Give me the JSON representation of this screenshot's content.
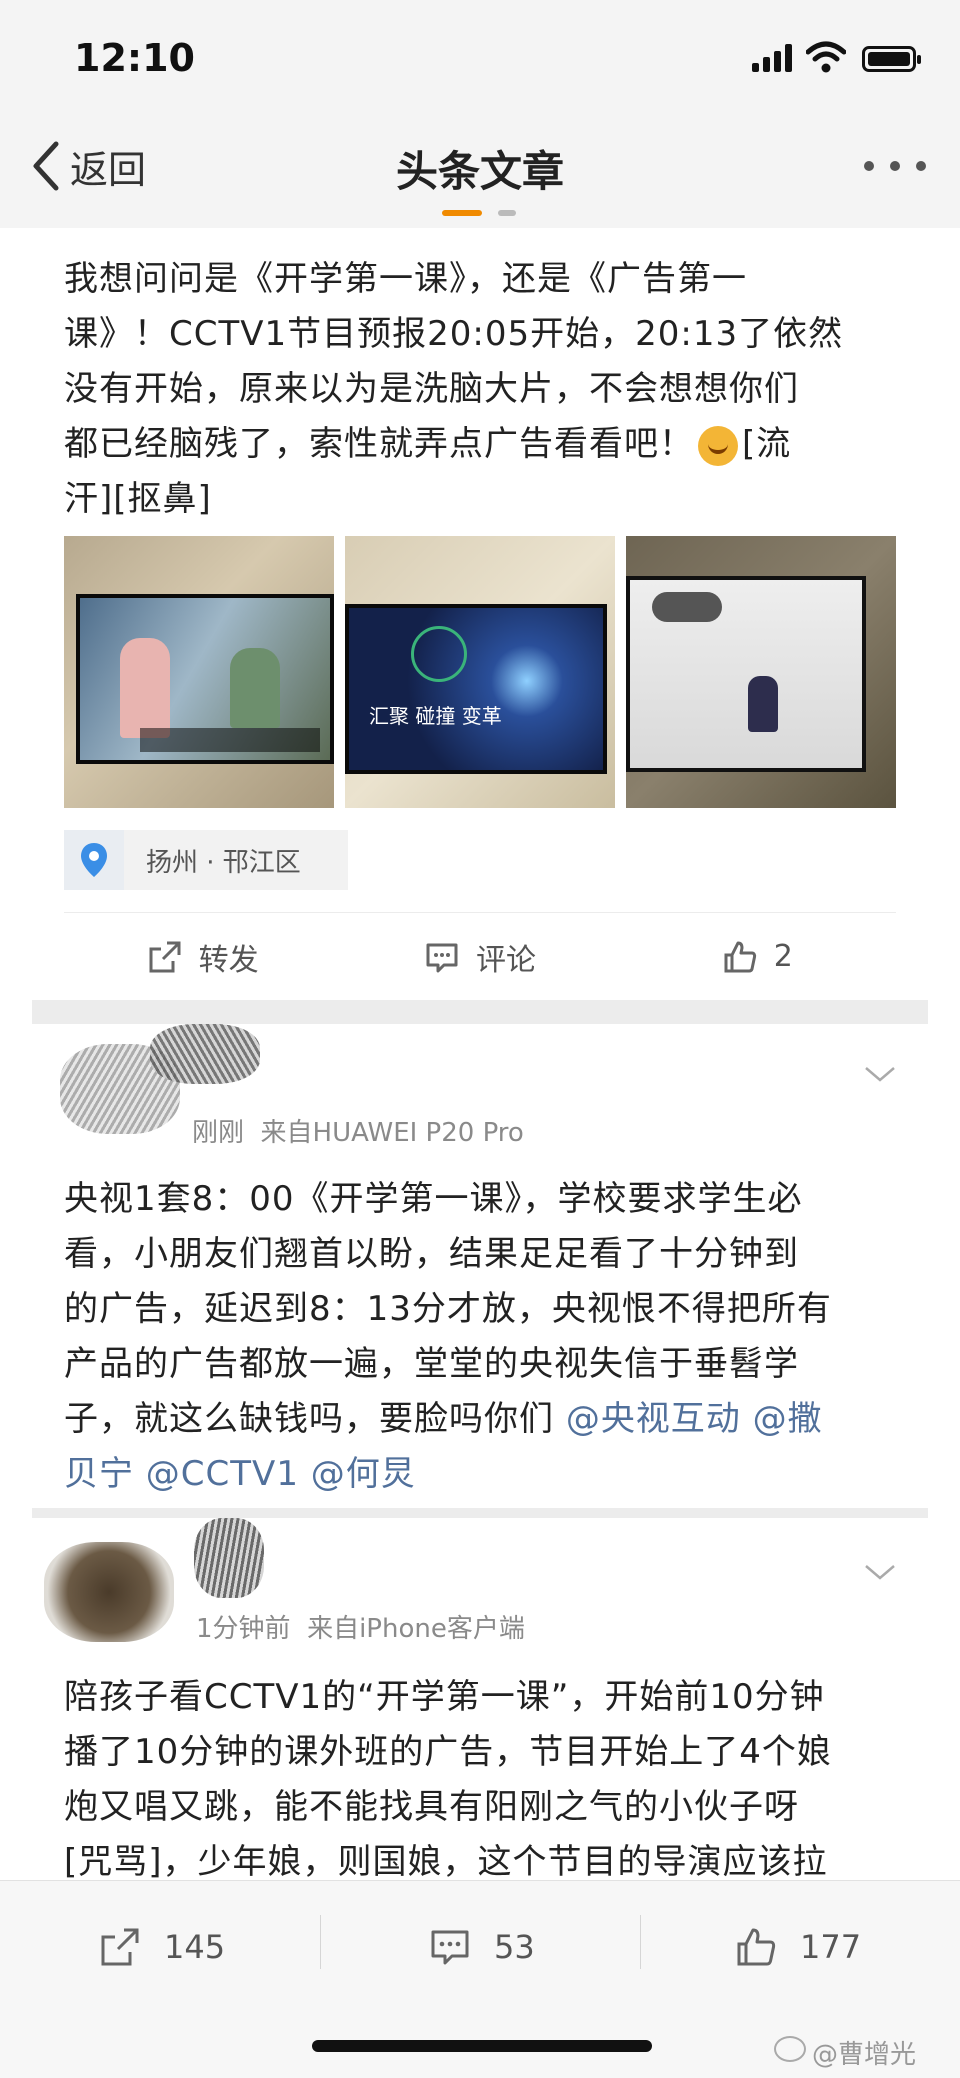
{
  "status_bar": {
    "time": "12:10"
  },
  "nav": {
    "back_label": "返回",
    "title": "头条文章"
  },
  "post": {
    "text_line1": "我想问问是《开学第一课》，还是《广告第一",
    "text_line2": "课》！CCTV1节目预报20:05开始，20:13了依然",
    "text_line3": "没有开始，原来以为是洗脑大片，不会想想你们",
    "text_line4_a": "都已经脑残了，索性就弄点广告看看吧！",
    "text_line4_b": "[流",
    "text_line5": "汗][抠鼻]",
    "photo2_caption": "汇聚 碰撞 变革",
    "location": "扬州 · 邗江区",
    "actions": {
      "forward": "转发",
      "comment": "评论",
      "like_count": "2"
    }
  },
  "comments": [
    {
      "meta_name": "刚刚",
      "meta_source": "来自HUAWEI P20 Pro",
      "line1": "央视1套8：00《开学第一课》，学校要求学生必",
      "line2": "看，小朋友们翘首以盼，结果足足看了十分钟到",
      "line3": "的广告，延迟到8：13分才放，央视恨不得把所有",
      "line4": "产品的广告都放一遍，堂堂的央视失信于垂髫学",
      "line5_text": "子，就这么缺钱吗，要脸吗你们 ",
      "mention1": "@央视互动",
      "mention2": " @撒",
      "line6_mention_a": "贝宁",
      "mention3": " @CCTV1",
      "mention4": " @何炅"
    },
    {
      "meta_name": "1分钟前",
      "meta_source": "来自iPhone客户端",
      "line1": "陪孩子看CCTV1的“开学第一课”，开始前10分钟",
      "line2": "播了10分钟的课外班的广告，节目开始上了4个娘",
      "line3": "炮又唱又跳，能不能找具有阳刚之气的小伙子呀",
      "line4": "[咒骂]，少年娘，则国娘，这个节目的导演应该拉"
    }
  ],
  "bottom_bar": {
    "forward_count": "145",
    "comment_count": "53",
    "like_count": "177"
  },
  "watermark": "@曹增光",
  "colors": {
    "accent": "#f08a00",
    "mention": "#51709b"
  }
}
